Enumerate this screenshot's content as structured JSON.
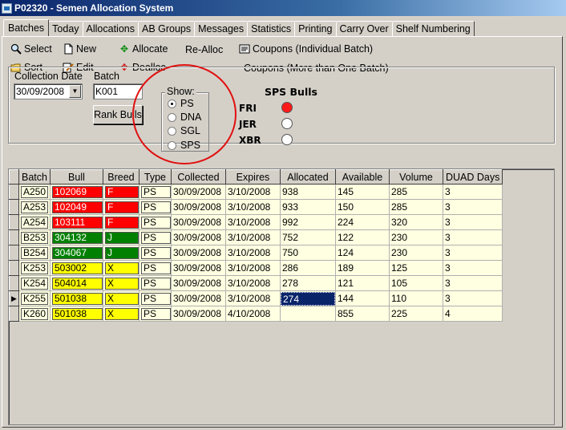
{
  "window": {
    "title": "P02320 - Semen Allocation System"
  },
  "tabs": [
    {
      "label": "Batches",
      "active": true
    },
    {
      "label": "Today",
      "active": false
    },
    {
      "label": "Allocations",
      "active": false
    },
    {
      "label": "AB Groups",
      "active": false
    },
    {
      "label": "Messages",
      "active": false
    },
    {
      "label": "Statistics",
      "active": false
    },
    {
      "label": "Printing",
      "active": false
    },
    {
      "label": "Carry Over",
      "active": false
    },
    {
      "label": "Shelf Numbering",
      "active": false
    }
  ],
  "toolbar": {
    "select": "Select",
    "new": "New",
    "allocate": "Allocate",
    "realloc": "Re-Alloc",
    "coupons_individual": "Coupons (Individual Batch)",
    "sort": "Sort",
    "edit": "Edit",
    "dealloc": "Dealloc",
    "coupons_multi": "Coupons (More than One Batch)"
  },
  "filters": {
    "collection_date_label": "Collection Date",
    "collection_date_value": "30/09/2008",
    "batch_label": "Batch",
    "batch_value": "K001",
    "rank_bulls": "Rank Bulls",
    "show_label": "Show:",
    "show_options": [
      {
        "label": "PS",
        "selected": true
      },
      {
        "label": "DNA",
        "selected": false
      },
      {
        "label": "SGL",
        "selected": false
      },
      {
        "label": "SPS",
        "selected": false
      }
    ]
  },
  "sps_bulls": {
    "title": "SPS Bulls",
    "items": [
      {
        "label": "FRI",
        "on": true
      },
      {
        "label": "JER",
        "on": false
      },
      {
        "label": "XBR",
        "on": false
      }
    ],
    "on_color": "#ff1a1a"
  },
  "grid": {
    "columns": [
      "Batch",
      "Bull",
      "Breed",
      "Type",
      "Collected",
      "Expires",
      "Allocated",
      "Available",
      "Volume",
      "DUAD Days"
    ],
    "breed_colors": {
      "F": "#ff0000",
      "J": "#008000",
      "X": "#ffff00"
    },
    "rows": [
      {
        "batch": "A250",
        "bull": "102069",
        "breed": "F",
        "type": "PS",
        "collected": "30/09/2008",
        "expires": "3/10/2008",
        "allocated": "938",
        "available": "145",
        "volume": "285",
        "duad": "3"
      },
      {
        "batch": "A253",
        "bull": "102049",
        "breed": "F",
        "type": "PS",
        "collected": "30/09/2008",
        "expires": "3/10/2008",
        "allocated": "933",
        "available": "150",
        "volume": "285",
        "duad": "3"
      },
      {
        "batch": "A254",
        "bull": "103111",
        "breed": "F",
        "type": "PS",
        "collected": "30/09/2008",
        "expires": "3/10/2008",
        "allocated": "992",
        "available": "224",
        "volume": "320",
        "duad": "3"
      },
      {
        "batch": "B253",
        "bull": "304132",
        "breed": "J",
        "type": "PS",
        "collected": "30/09/2008",
        "expires": "3/10/2008",
        "allocated": "752",
        "available": "122",
        "volume": "230",
        "duad": "3"
      },
      {
        "batch": "B254",
        "bull": "304067",
        "breed": "J",
        "type": "PS",
        "collected": "30/09/2008",
        "expires": "3/10/2008",
        "allocated": "750",
        "available": "124",
        "volume": "230",
        "duad": "3"
      },
      {
        "batch": "K253",
        "bull": "503002",
        "breed": "X",
        "type": "PS",
        "collected": "30/09/2008",
        "expires": "3/10/2008",
        "allocated": "286",
        "available": "189",
        "volume": "125",
        "duad": "3"
      },
      {
        "batch": "K254",
        "bull": "504014",
        "breed": "X",
        "type": "PS",
        "collected": "30/09/2008",
        "expires": "3/10/2008",
        "allocated": "278",
        "available": "121",
        "volume": "105",
        "duad": "3"
      },
      {
        "batch": "K255",
        "bull": "501038",
        "breed": "X",
        "type": "PS",
        "collected": "30/09/2008",
        "expires": "3/10/2008",
        "allocated": "274",
        "available": "144",
        "volume": "110",
        "duad": "3",
        "current": true
      },
      {
        "batch": "K260",
        "bull": "501038",
        "breed": "X",
        "type": "PS",
        "collected": "30/09/2008",
        "expires": "4/10/2008",
        "allocated": "",
        "available": "855",
        "volume": "225",
        "duad": "4"
      }
    ]
  }
}
